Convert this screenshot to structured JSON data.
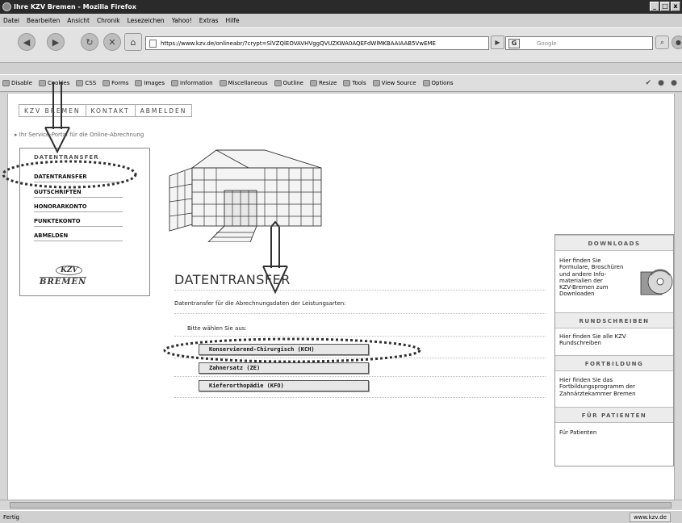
{
  "window": {
    "title": "Ihre KZV Bremen - Mozilla Firefox",
    "controls": [
      "_",
      "□",
      "x"
    ]
  },
  "menubar": [
    "Datei",
    "Bearbeiten",
    "Ansicht",
    "Chronik",
    "Lesezeichen",
    "Yahoo!",
    "Extras",
    "Hilfe"
  ],
  "navigation": {
    "url": "https://www.kzv.de/onlineabr/?crypt=SlVZQlEOVAVHVggQVUZKWA0AQEFdWlMKBAAIAAB5VwEME",
    "search_placeholder": "Google",
    "search_engine_icon": "G"
  },
  "devbar": [
    "Disable",
    "Cookies",
    "CSS",
    "Forms",
    "Images",
    "Information",
    "Miscellaneous",
    "Outline",
    "Resize",
    "Tools",
    "View Source",
    "Options"
  ],
  "page": {
    "topnav": [
      "KZV BREMEN",
      "KONTAKT",
      "ABMELDEN"
    ],
    "breadcrumb": "Ihr Service-Portal für die Online-Abrechnung",
    "sidebar": {
      "heading": "DATENTRANSFER",
      "items": [
        "DATENTRANSFER",
        "GUTSCHRIFTEN",
        "HONORARKONTO",
        "PUNKTEKONTO",
        "ABMELDEN"
      ],
      "logo_top": "KZV",
      "logo_bottom": "BREMEN"
    },
    "main": {
      "title": "DATENTRANSFER",
      "subtitle": "Datentransfer für die Abrechnungsdaten der Leistungsarten:",
      "prompt": "Bitte wählen Sie aus:",
      "choices": [
        "Konservierend-Chirurgisch (KCH)",
        "Zahnersatz (ZE)",
        "Kieferorthopädie (KFO)"
      ]
    },
    "right": {
      "boxes": [
        {
          "heading": "DOWNLOADS",
          "text": "Hier finden Sie\nFormulare, Broschüren\nund andere Info-\nmaterialien der\nKZV-Bremen zum\nDownloaden"
        },
        {
          "heading": "RUNDSCHREIBEN",
          "text": "Hier finden Sie alle KZV\nRundschreiben"
        },
        {
          "heading": "FORTBILDUNG",
          "text": "Hier finden Sie das\nFortbildungsprogramm der\nZahnärztekammer Bremen"
        },
        {
          "heading": "FÜR PATIENTEN",
          "text": "Für Patienten"
        }
      ]
    }
  },
  "status": {
    "text": "Fertig",
    "host": "www.kzv.de"
  },
  "annotation_color": "#e00000"
}
